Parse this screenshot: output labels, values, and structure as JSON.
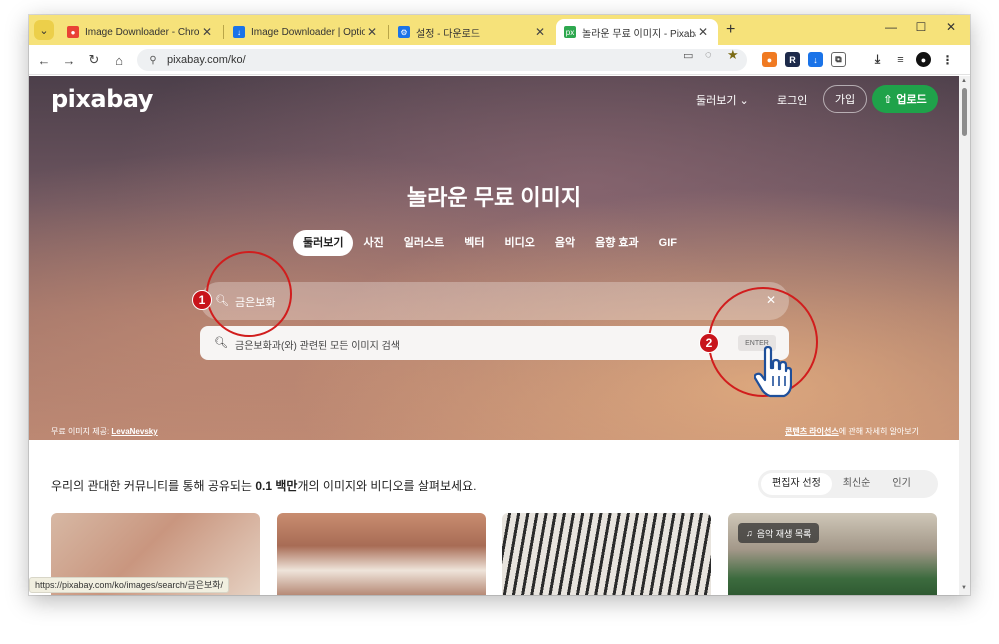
{
  "browser": {
    "tabs": [
      {
        "title": "Image Downloader - Chrome",
        "favicon_color": "#e94235"
      },
      {
        "title": "Image Downloader | Options",
        "favicon_color": "#1a73e8"
      },
      {
        "title": "설정 - 다운로드",
        "favicon_color": "#1a73e8"
      },
      {
        "title": "놀라운 무료 이미지 - Pixabay",
        "favicon_color": "#2ea84f"
      }
    ],
    "new_tab": "+",
    "url": "pixabay.com/ko/",
    "status_url": "https://pixabay.com/ko/images/search/금은보화/"
  },
  "header": {
    "logo": "pixabay",
    "explore": "둘러보기",
    "login": "로그인",
    "join": "가입",
    "upload": "업로드"
  },
  "hero": {
    "title": "놀라운 무료 이미지",
    "categories": [
      "둘러보기",
      "사진",
      "일러스트",
      "벡터",
      "비디오",
      "음악",
      "음향 효과",
      "GIF"
    ],
    "search_value": "금은보화",
    "suggestion": "금은보화과(와) 관련된 모든 이미지 검색",
    "enter_label": "ENTER",
    "credit_prefix": "무료 이미지 제공:",
    "credit_author": "LevaNevsky",
    "license_link": "콘텐츠 라이선스",
    "license_suffix": "에 관해 자세히 알아보기"
  },
  "annotations": {
    "badge1": "1",
    "badge2": "2",
    "color": "#d11d1d"
  },
  "community": {
    "prefix": "우리의 관대한 커뮤니티를 통해 공유되는",
    "number": "0.1 백만",
    "suffix": "개의 이미지와 비디오를 살펴보세요.",
    "sorts": [
      "편집자 선정",
      "최신순",
      "인기"
    ]
  },
  "thumbnails": {
    "playlist_badge": "음악 재생 목록"
  }
}
